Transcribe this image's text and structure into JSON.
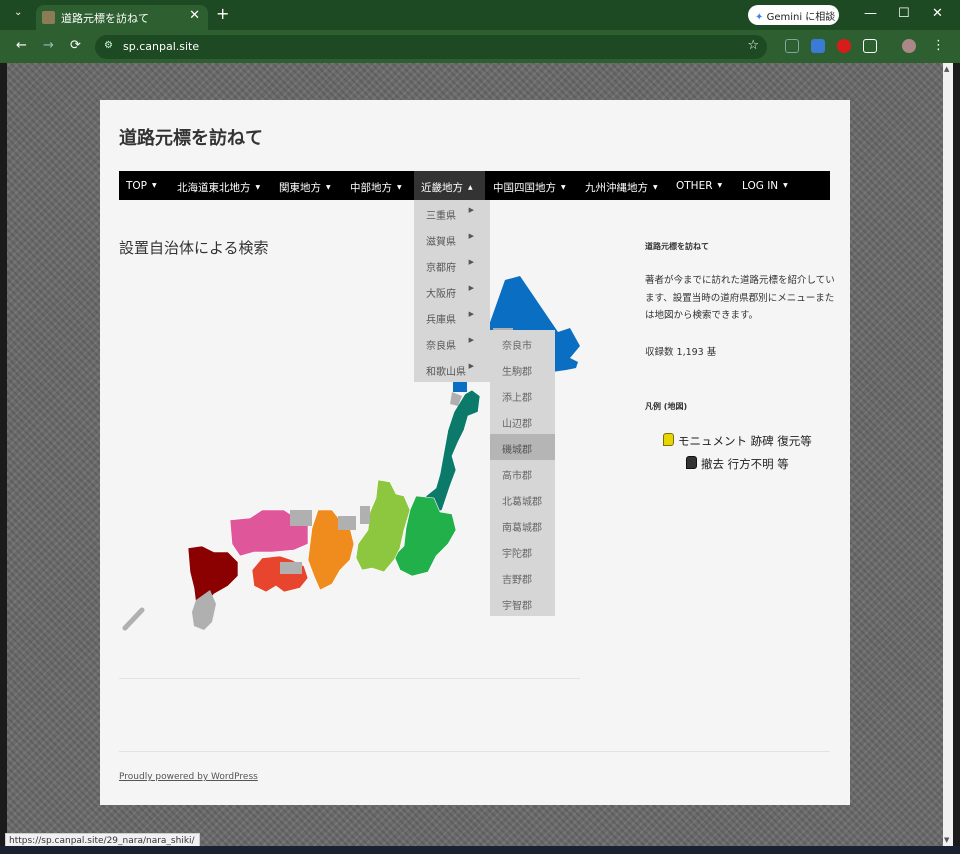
{
  "browser": {
    "tab_title": "道路元標を訪ねて",
    "tab_close": "✕",
    "new_tab": "+",
    "tab_menu": "⌄",
    "gemini_label": "Gemini に相談",
    "gemini_icon": "✦",
    "url": "sp.canpal.site",
    "controls": {
      "minimize": "—",
      "maximize": "☐",
      "close": "✕"
    },
    "back": "←",
    "forward": "→",
    "reload": "⟳",
    "menu": "⋮",
    "bookmark": "☆",
    "status_url": "https://sp.canpal.site/29_nara/nara_shiki/"
  },
  "site": {
    "title": "道路元標を訪ねて",
    "nav": [
      {
        "label": "TOP"
      },
      {
        "label": "北海道東北地方"
      },
      {
        "label": "関東地方"
      },
      {
        "label": "中部地方"
      },
      {
        "label": "近畿地方",
        "active": true
      },
      {
        "label": "中国四国地方"
      },
      {
        "label": "九州沖縄地方"
      },
      {
        "label": "OTHER"
      },
      {
        "label": "LOG IN"
      }
    ],
    "caret_down": "▼",
    "caret_up": "▲",
    "submenu_arrow": "▶",
    "kinki_menu": [
      "三重県",
      "滋賀県",
      "京都府",
      "大阪府",
      "兵庫県",
      "奈良県",
      "和歌山県"
    ],
    "nara_menu": [
      "奈良市",
      "生駒郡",
      "添上郡",
      "山辺郡",
      "磯城郡",
      "高市郡",
      "北葛城郡",
      "南葛城郡",
      "宇陀郡",
      "吉野郡",
      "宇智郡"
    ],
    "nara_highlighted": "磯城郡",
    "page_heading": "設置自治体による検索",
    "footer": "Proudly powered by WordPress"
  },
  "sidebar": {
    "title": "道路元標を訪ねて",
    "description": "著者が今までに訪れた道路元標を紹介しています、設置当時の道府県郡別にメニューまたは地図から検索できます。",
    "count": "収録数 1,193 基",
    "legend_title": "凡例 (地図)",
    "legend": [
      {
        "label": "モニュメント 跡碑 復元等",
        "pin": "yellow-pin-icon"
      },
      {
        "label": "撤去 行方不明 等",
        "pin": "gray-pin-icon"
      }
    ]
  },
  "colors": {
    "hokkaido": "#0a6fc2",
    "tohoku": "#0b7a6a",
    "kanto": "#22b04a",
    "chubu_east": "#8dc63f",
    "chubu_west": "#f08c1e",
    "kinki": "#e8452e",
    "chugoku": "#e0569a",
    "kyushu": "#8b0000",
    "unvisited": "#b0b0b0"
  }
}
